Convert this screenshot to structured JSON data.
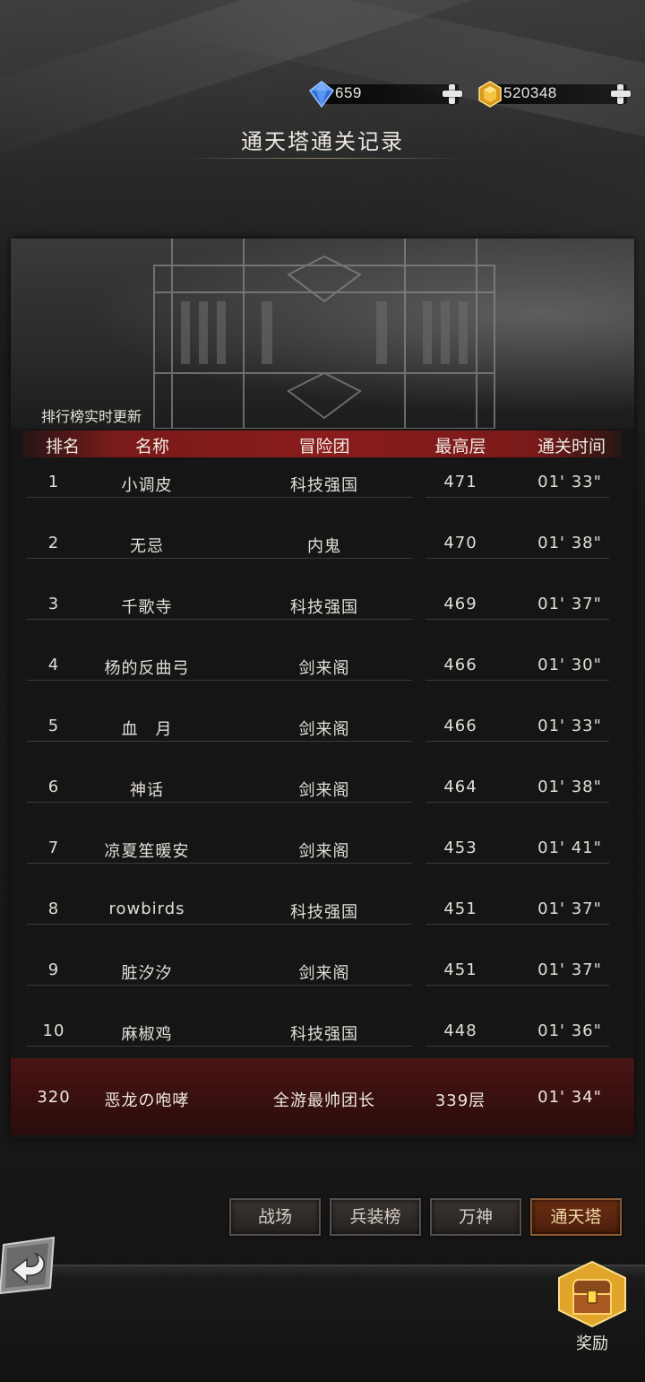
{
  "currency": {
    "diamond": {
      "value": "659",
      "icon": "blue-diamond-icon"
    },
    "gold": {
      "value": "520348",
      "icon": "gold-gem-icon"
    }
  },
  "title": "通天塔通关记录",
  "update_note": "排行榜实时更新",
  "table": {
    "headers": [
      "排名",
      "名称",
      "冒险团",
      "最高层",
      "通关时间"
    ],
    "rows": [
      {
        "rank": "1",
        "name": "小调皮",
        "guild": "科技强国",
        "floor": "471",
        "time": "01' 33\""
      },
      {
        "rank": "2",
        "name": "无忌",
        "guild": "内鬼",
        "floor": "470",
        "time": "01' 38\""
      },
      {
        "rank": "3",
        "name": "千歌寺",
        "guild": "科技强国",
        "floor": "469",
        "time": "01' 37\""
      },
      {
        "rank": "4",
        "name": "杨的反曲弓",
        "guild": "剑来阁",
        "floor": "466",
        "time": "01' 30\""
      },
      {
        "rank": "5",
        "name": "血　月",
        "guild": "剑来阁",
        "floor": "466",
        "time": "01' 33\""
      },
      {
        "rank": "6",
        "name": "神话",
        "guild": "剑来阁",
        "floor": "464",
        "time": "01' 38\""
      },
      {
        "rank": "7",
        "name": "凉夏笙暖安",
        "guild": "剑来阁",
        "floor": "453",
        "time": "01' 41\""
      },
      {
        "rank": "8",
        "name": "rowbirds",
        "guild": "科技强国",
        "floor": "451",
        "time": "01' 37\""
      },
      {
        "rank": "9",
        "name": "脏汐汐",
        "guild": "剑来阁",
        "floor": "451",
        "time": "01' 37\""
      },
      {
        "rank": "10",
        "name": "麻椒鸡",
        "guild": "科技强国",
        "floor": "448",
        "time": "01' 36\""
      }
    ]
  },
  "my_record": {
    "rank": "320",
    "name": "恶龙の咆哮",
    "guild": "全游最帅团长",
    "floor": "339层",
    "time": "01' 34\""
  },
  "tabs": [
    {
      "label": "战场",
      "active": false
    },
    {
      "label": "兵装榜",
      "active": false
    },
    {
      "label": "万神",
      "active": false
    },
    {
      "label": "通天塔",
      "active": true
    }
  ],
  "reward_label": "奖励",
  "colors": {
    "accent_red": "#8a1c1c",
    "active_tab": "#6a2e12",
    "gold": "#e8b436",
    "diamond": "#3a7be0"
  }
}
